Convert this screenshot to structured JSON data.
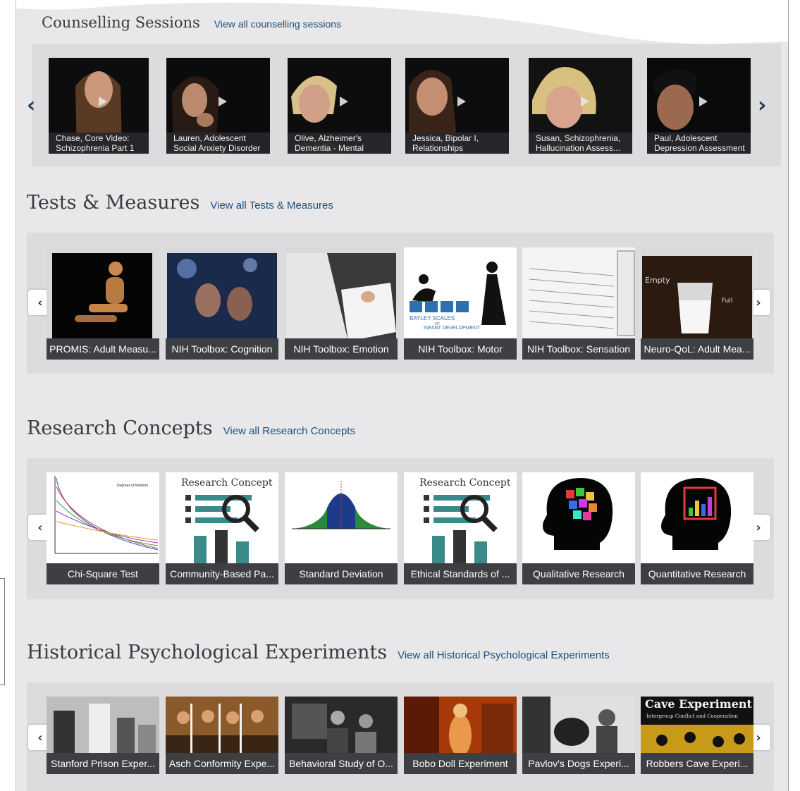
{
  "counselling": {
    "title": "Counselling Sessions",
    "view_all": "View all counselling sessions",
    "videos": [
      {
        "line1": "Chase, Core Video:",
        "line2": "Schizophrenia Part 1"
      },
      {
        "line1": "Lauren, Adolescent",
        "line2": "Social Anxiety Disorder"
      },
      {
        "line1": "Olive, Alzheimer's",
        "line2": "Dementia - Mental Status"
      },
      {
        "line1": "Jessica, Bipolar I,",
        "line2": "Relationships"
      },
      {
        "line1": "Susan, Schizophrenia,",
        "line2": "Hallucination Assess..."
      },
      {
        "line1": "Paul, Adolescent",
        "line2": "Depression Assessment"
      }
    ]
  },
  "tests": {
    "title": "Tests & Measures",
    "view_all": "View all Tests & Measures",
    "items": [
      {
        "label": "PROMIS: Adult Measu..."
      },
      {
        "label": "NIH Toolbox: Cognition"
      },
      {
        "label": "NIH Toolbox: Emotion"
      },
      {
        "label": "NIH Toolbox: Motor",
        "art_text1": "BAYLEY SCALES",
        "art_text2": "OF",
        "art_text3": "INFANT DEVELOPMENT"
      },
      {
        "label": "NIH Toolbox: Sensation"
      },
      {
        "label": "Neuro-QoL: Adult Mea...",
        "art_text1": "Empty",
        "art_text2": "Full"
      }
    ]
  },
  "research": {
    "title": "Research Concepts",
    "view_all": "View all Research Concepts",
    "items": [
      {
        "label": "Chi-Square Test",
        "art_text1": "Degrees of freedom"
      },
      {
        "label": "Community-Based Pa...",
        "art_text1": "Research Concept"
      },
      {
        "label": "Standard Deviation"
      },
      {
        "label": "Ethical Standards of ...",
        "art_text1": "Research Concept"
      },
      {
        "label": "Qualitative Research"
      },
      {
        "label": "Quantitative Research"
      }
    ]
  },
  "historical": {
    "title": "Historical Psychological Experiments",
    "view_all": "View all Historical Psychological Experiments",
    "items": [
      {
        "label": "Stanford Prison Exper..."
      },
      {
        "label": "Asch Conformity Expe..."
      },
      {
        "label": "Behavioral Study of O..."
      },
      {
        "label": "Bobo Doll Experiment"
      },
      {
        "label": "Pavlov's Dogs Experi..."
      },
      {
        "label": "Robbers Cave Experi...",
        "art_text1": "Cave Experiment",
        "art_text2": "Intergroup Conflict and Cooperation"
      }
    ]
  },
  "arrows": {
    "left": "‹",
    "right": "›"
  },
  "colors": {
    "link": "#1e4f7a",
    "caption_bg": "#3d3f42",
    "panel": "#dcdcdf",
    "arrow": "#1f3f5c"
  }
}
